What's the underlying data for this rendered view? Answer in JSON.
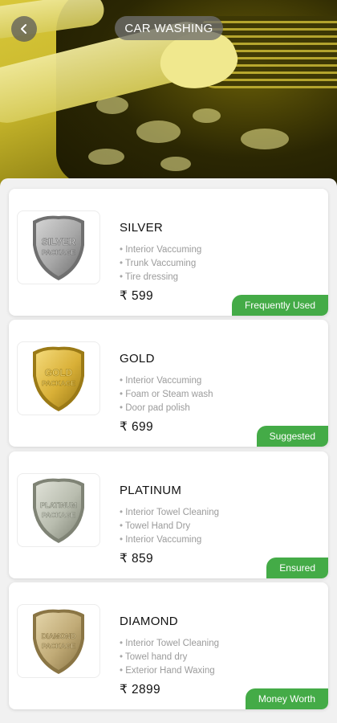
{
  "header": {
    "title": "CAR WASHING"
  },
  "icons": {
    "back": "back-arrow-icon"
  },
  "packages": [
    {
      "name": "SILVER",
      "features": [
        "Interior Vaccuming",
        "Trunk Vaccuming",
        "Tire dressing"
      ],
      "price": "₹ 599",
      "badge": "Frequently Used",
      "shield": {
        "label_line1": "SILVER",
        "label_line2": "PACKAGE",
        "color": "#a7a7a7",
        "dark": "#6f6f6f",
        "light": "#d4d4d4"
      }
    },
    {
      "name": "GOLD",
      "features": [
        "Interior Vaccuming",
        "Foam or Steam wash",
        "Door pad polish"
      ],
      "price": "₹ 699",
      "badge": "Suggested",
      "shield": {
        "label_line1": "GOLD",
        "label_line2": "PACKAGE",
        "color": "#d9b037",
        "dark": "#9b7a16",
        "light": "#f4da7a"
      }
    },
    {
      "name": "PLATINUM",
      "features": [
        "Interior Towel Cleaning",
        "Towel Hand Dry",
        " Interior Vaccuming"
      ],
      "price": "₹ 859",
      "badge": "Ensured",
      "shield": {
        "label_line1": "PLATINUM",
        "label_line2": "PACKAGE",
        "color": "#b9bdaf",
        "dark": "#7f8375",
        "light": "#dfe1d7"
      }
    },
    {
      "name": "DIAMOND",
      "features": [
        "Interior Towel Cleaning",
        "Towel hand dry",
        " Exterior Hand Waxing"
      ],
      "price": "₹ 2899",
      "badge": "Money Worth",
      "shield": {
        "label_line1": "DIAMOND",
        "label_line2": "PACKAGE",
        "color": "#c1ab77",
        "dark": "#8a7544",
        "light": "#e3d4a8"
      }
    }
  ],
  "colors": {
    "badge": "#44ab47",
    "hero_tint": "#d8c73a"
  }
}
